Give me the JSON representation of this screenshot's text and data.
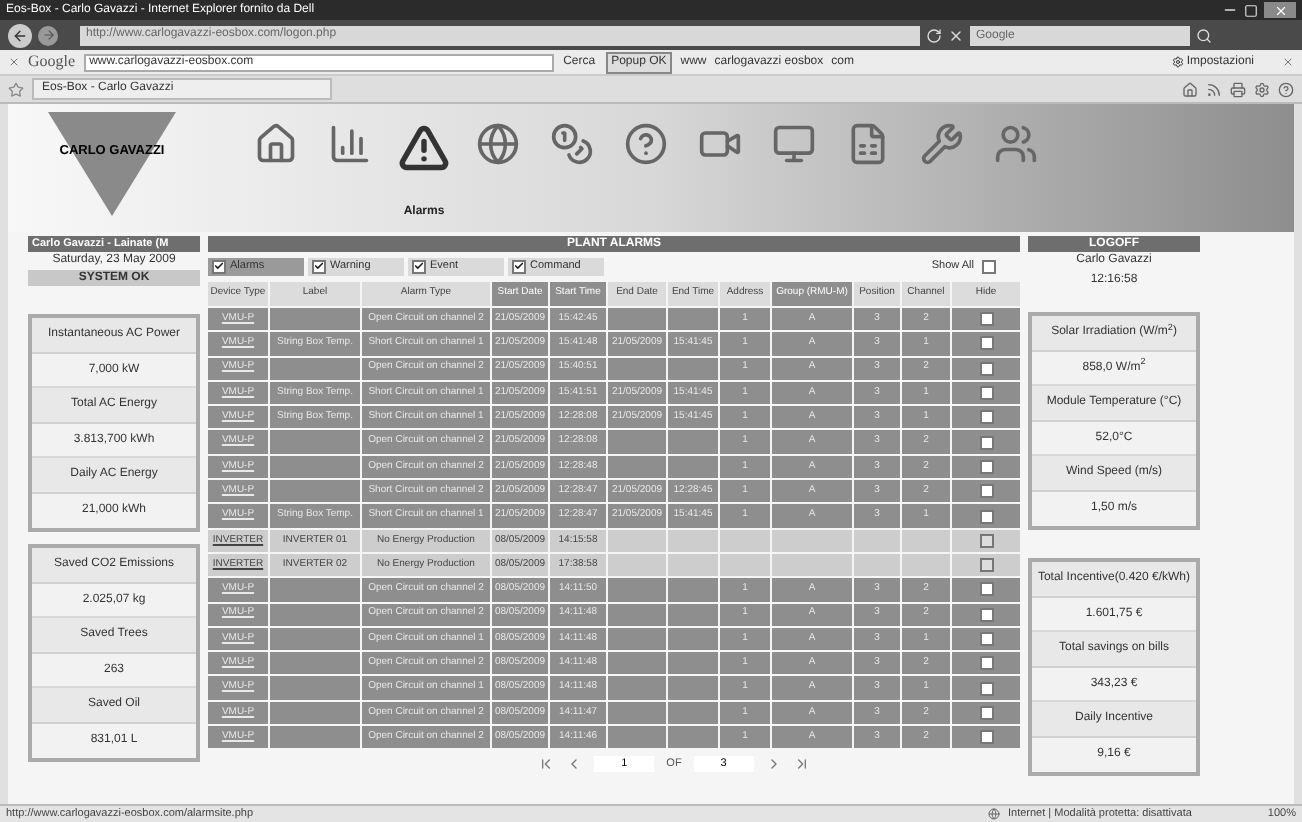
{
  "browser": {
    "title": "Eos-Box - Carlo Gavazzi - Internet Explorer fornito da Dell",
    "address": "http://www.carlogavazzi-eosbox.com/logon.php",
    "search_placeholder": "Google",
    "toolbar": {
      "logo": "Google",
      "query": "www.carlogavazzi-eosbox.com",
      "search_button": "Cerca",
      "popup_button": "Popup OK",
      "links": [
        "www",
        "carlogavazzi eosbox",
        "com"
      ],
      "settings": "Impostazioni"
    },
    "tab": "Eos-Box - Carlo Gavazzi"
  },
  "header": {
    "logo": "CARLO GAVAZZI",
    "nav": [
      {
        "kind": "home",
        "selected": false
      },
      {
        "kind": "chart",
        "selected": false
      },
      {
        "kind": "alarm",
        "selected": true,
        "label": "Alarms"
      },
      {
        "kind": "globe",
        "selected": false
      },
      {
        "kind": "money",
        "selected": false
      },
      {
        "kind": "help",
        "selected": false
      },
      {
        "kind": "camera",
        "selected": false
      },
      {
        "kind": "monitor",
        "selected": false
      },
      {
        "kind": "spreadsheet",
        "selected": false
      },
      {
        "kind": "tools",
        "selected": false
      },
      {
        "kind": "users",
        "selected": false
      }
    ]
  },
  "left": {
    "site": "Carlo Gavazzi - Lainate (M",
    "date": "Saturday, 23 May 2009",
    "status": "SYSTEM OK",
    "boxes": [
      [
        {
          "label": "Instantaneous AC Power",
          "value": "7,000 kW"
        },
        {
          "label": "Total AC Energy",
          "value": "3.813,700 kWh"
        },
        {
          "label": "Daily AC Energy",
          "value": "21,000 kWh"
        }
      ],
      [
        {
          "label": "Saved CO2 Emissions",
          "value": "2.025,07 kg"
        },
        {
          "label": "Saved Trees",
          "value": "263"
        },
        {
          "label": "Saved Oil",
          "value": "831,01 L"
        }
      ]
    ]
  },
  "alarms": {
    "title": "PLANT ALARMS",
    "filters": [
      {
        "label": "Alarms",
        "checked": true,
        "selected": true
      },
      {
        "label": "Warning",
        "checked": true,
        "selected": false
      },
      {
        "label": "Event",
        "checked": true,
        "selected": false
      },
      {
        "label": "Command",
        "checked": true,
        "selected": false
      }
    ],
    "show_all": {
      "label": "Show All",
      "checked": false
    },
    "columns": [
      {
        "kind": "link",
        "label": "Device Type",
        "sorted": false
      },
      {
        "kind": "text",
        "label": "Label",
        "sorted": false
      },
      {
        "kind": "text",
        "label": "Alarm Type",
        "sorted": false
      },
      {
        "kind": "text",
        "label": "Start Date",
        "sorted": true
      },
      {
        "kind": "text",
        "label": "Start Time",
        "sorted": true
      },
      {
        "kind": "text",
        "label": "End Date",
        "sorted": false
      },
      {
        "kind": "text",
        "label": "End Time",
        "sorted": false
      },
      {
        "kind": "text",
        "label": "Address",
        "sorted": false
      },
      {
        "kind": "text",
        "label": "Group (RMU-M)",
        "sorted": true
      },
      {
        "kind": "text",
        "label": "Position",
        "sorted": false
      },
      {
        "kind": "text",
        "label": "Channel",
        "sorted": false
      },
      {
        "kind": "checkbox",
        "label": "Hide",
        "sorted": false
      }
    ],
    "rows": [
      {
        "kind": "vmu",
        "cells": [
          "VMU-P",
          null,
          "Open Circuit on channel 2",
          "21/05/2009",
          "15:42:45",
          null,
          null,
          "1",
          "A",
          "3",
          "2"
        ],
        "hide": false
      },
      {
        "kind": "vmu",
        "cells": [
          "VMU-P",
          "String Box Temp.",
          "Short Circuit on channel 1",
          "21/05/2009",
          "15:41:48",
          "21/05/2009",
          "15:41:45",
          "1",
          "A",
          "3",
          "1"
        ],
        "hide": false
      },
      {
        "kind": "vmu",
        "cells": [
          "VMU-P",
          null,
          "Open Circuit on channel 2",
          "21/05/2009",
          "15:40:51",
          null,
          null,
          "1",
          "A",
          "3",
          "2"
        ],
        "hide": false
      },
      {
        "kind": "vmu",
        "cells": [
          "VMU-P",
          "String Box Temp.",
          "Short Circuit on channel 1",
          "21/05/2009",
          "15:41:51",
          "21/05/2009",
          "15:41:45",
          "1",
          "A",
          "3",
          "1"
        ],
        "hide": false
      },
      {
        "kind": "vmu",
        "cells": [
          "VMU-P",
          "String Box Temp.",
          "Short Circuit on channel 1",
          "21/05/2009",
          "12:28:08",
          "21/05/2009",
          "15:41:45",
          "1",
          "A",
          "3",
          "1"
        ],
        "hide": false
      },
      {
        "kind": "vmu",
        "cells": [
          "VMU-P",
          null,
          "Open Circuit on channel 2",
          "21/05/2009",
          "12:28:08",
          null,
          null,
          "1",
          "A",
          "3",
          "2"
        ],
        "hide": false
      },
      {
        "kind": "vmu",
        "cells": [
          "VMU-P",
          null,
          "Open Circuit on channel 2",
          "21/05/2009",
          "12:28:48",
          null,
          null,
          "1",
          "A",
          "3",
          "2"
        ],
        "hide": false
      },
      {
        "kind": "vmu",
        "cells": [
          "VMU-P",
          null,
          "Short Circuit on channel 2",
          "21/05/2009",
          "12:28:47",
          "21/05/2009",
          "12:28:45",
          "1",
          "A",
          "3",
          "2"
        ],
        "hide": false
      },
      {
        "kind": "vmu",
        "cells": [
          "VMU-P",
          "String Box Temp.",
          "Short Circuit on channel 1",
          "21/05/2009",
          "12:28:47",
          "21/05/2009",
          "15:41:45",
          "1",
          "A",
          "3",
          "1"
        ],
        "hide": false
      },
      {
        "kind": "inverter",
        "cells": [
          "INVERTER",
          "INVERTER 01",
          "No Energy Production",
          "08/05/2009",
          "14:15:58",
          null,
          null,
          null,
          null,
          null,
          null
        ],
        "hide": false
      },
      {
        "kind": "inverter",
        "cells": [
          "INVERTER",
          "INVERTER 02",
          "No Energy Production",
          "08/05/2009",
          "17:38:58",
          null,
          null,
          null,
          null,
          null,
          null
        ],
        "hide": false
      },
      {
        "kind": "vmu",
        "cells": [
          "VMU-P",
          null,
          "Open Circuit on channel 2",
          "08/05/2009",
          "14:11:50",
          null,
          null,
          "1",
          "A",
          "3",
          "2"
        ],
        "hide": false
      },
      {
        "kind": "vmu",
        "cells": [
          "VMU-P",
          null,
          "Open Circuit on channel 2",
          "08/05/2009",
          "14:11:48",
          null,
          null,
          "1",
          "A",
          "3",
          "2"
        ],
        "hide": false
      },
      {
        "kind": "vmu",
        "cells": [
          "VMU-P",
          null,
          "Open Circuit on channel 1",
          "08/05/2009",
          "14:11:48",
          null,
          null,
          "1",
          "A",
          "3",
          "1"
        ],
        "hide": false
      },
      {
        "kind": "vmu",
        "cells": [
          "VMU-P",
          null,
          "Open Circuit on channel 2",
          "08/05/2009",
          "14:11:48",
          null,
          null,
          "1",
          "A",
          "3",
          "2"
        ],
        "hide": false
      },
      {
        "kind": "vmu",
        "cells": [
          "VMU-P",
          null,
          "Open Circuit on channel 1",
          "08/05/2009",
          "14:11:48",
          null,
          null,
          "1",
          "A",
          "3",
          "1"
        ],
        "hide": false
      },
      {
        "kind": "vmu",
        "cells": [
          "VMU-P",
          null,
          "Open Circuit on channel 2",
          "08/05/2009",
          "14:11:47",
          null,
          null,
          "1",
          "A",
          "3",
          "2"
        ],
        "hide": false
      },
      {
        "kind": "vmu",
        "cells": [
          "VMU-P",
          null,
          "Open Circuit on channel 2",
          "08/05/2009",
          "14:11:46",
          null,
          null,
          "1",
          "A",
          "3",
          "2"
        ],
        "hide": false
      }
    ],
    "pager": {
      "page": "1",
      "of": "OF",
      "total": "3"
    }
  },
  "right": {
    "logoff": "LOGOFF",
    "user": "Carlo Gavazzi",
    "time": "12:16:58",
    "boxes": [
      [
        {
          "label": "Solar Irradiation (W/m$^{2}$)",
          "value": "858,0 W/m$^{2}$"
        },
        {
          "label": "Module Temperature (°C)",
          "value": "52,0°C"
        },
        {
          "label": "Wind Speed (m/s)",
          "value": "1,50 m/s"
        }
      ],
      [
        {
          "label": "Total Incentive(0.420 €/kWh)",
          "value": "1.601,75 €"
        },
        {
          "label": "Total savings on bills",
          "value": "343,23 €"
        },
        {
          "label": "Daily Incentive",
          "value": "9,16 €"
        }
      ]
    ]
  },
  "status_bar": {
    "url": "http://www.carlogavazzi-eosbox.com/alarmsite.php",
    "zone": "Internet | Modalità protetta: disattivata",
    "zoom": "100%"
  }
}
